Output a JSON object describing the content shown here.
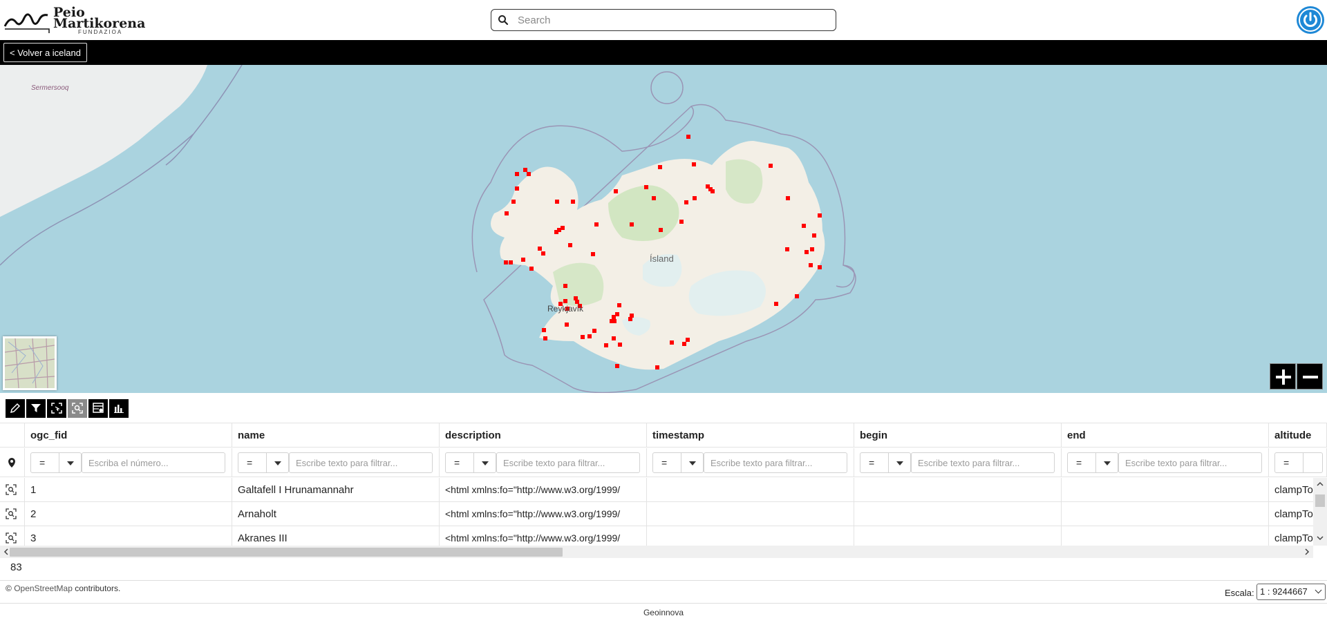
{
  "header": {
    "logo_line1": "Peio",
    "logo_line2": "Martikorena",
    "logo_sub": "FUNDAZIOA",
    "search_placeholder": "Search"
  },
  "nav": {
    "back_label": "< Volver a iceland"
  },
  "map": {
    "labels": {
      "sermersooq": "Sermersooq",
      "island": "Ísland",
      "reykjavik": "Reykjavík"
    },
    "marker_color": "#ff0000",
    "water_color": "#aad3df"
  },
  "table": {
    "columns": [
      "ogc_fid",
      "name",
      "description",
      "timestamp",
      "begin",
      "end",
      "altitude"
    ],
    "filter_operator": "=",
    "filter_placeholders": [
      "Escriba el número...",
      "Escribe texto para filtrar...",
      "Escribe texto para filtrar...",
      "Escribe texto para filtrar...",
      "Escribe texto para filtrar...",
      "Escribe texto para filtrar..."
    ],
    "rows": [
      {
        "ogc_fid": "1",
        "name": "Galtafell I Hrunamannahr",
        "description": "<html xmlns:fo=\"http://www.w3.org/1999/",
        "timestamp": "",
        "begin": "",
        "end": "",
        "altitude": "clampTo"
      },
      {
        "ogc_fid": "2",
        "name": "Arnaholt",
        "description": "<html xmlns:fo=\"http://www.w3.org/1999/",
        "timestamp": "",
        "begin": "",
        "end": "",
        "altitude": "clampTo"
      },
      {
        "ogc_fid": "3",
        "name": "Akranes III",
        "description": "<html xmlns:fo=\"http://www.w3.org/1999/",
        "timestamp": "",
        "begin": "",
        "end": "",
        "altitude": "clampTo"
      }
    ],
    "total_count": "83"
  },
  "footer": {
    "attribution_prefix": "©",
    "attribution_link": "OpenStreetMap",
    "attribution_suffix": "contributors.",
    "scale_label": "Escala:",
    "scale_value": "1 : 9244667",
    "credit": "Geoinnova"
  }
}
